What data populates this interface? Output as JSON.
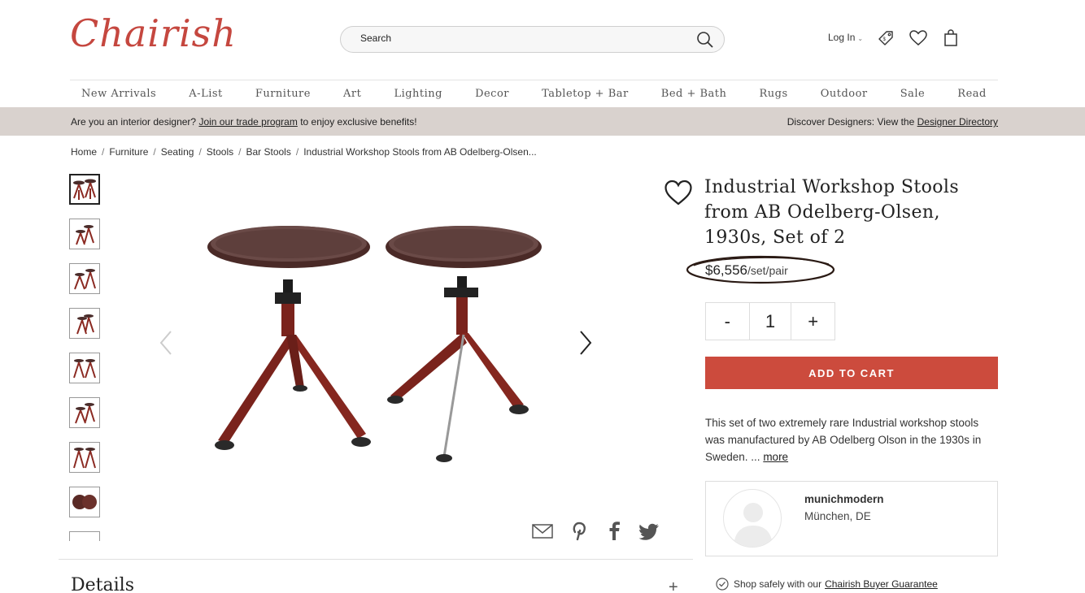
{
  "brand": {
    "logo_text": "Chairish",
    "accent_color": "#cc4b3d"
  },
  "header": {
    "search": {
      "placeholder": "Search",
      "icon": "search-icon"
    },
    "login_label": "Log In",
    "icons": [
      "price-tag-icon",
      "heart-icon",
      "shopping-bag-icon"
    ]
  },
  "nav": {
    "items": [
      "New Arrivals",
      "A-List",
      "Furniture",
      "Art",
      "Lighting",
      "Decor",
      "Tabletop + Bar",
      "Bed + Bath",
      "Rugs",
      "Outdoor",
      "Sale",
      "Read"
    ]
  },
  "promo": {
    "left_prefix": "Are you an interior designer?",
    "left_link": "Join our trade program",
    "left_suffix": "to enjoy exclusive benefits!",
    "right_prefix": "Discover Designers: View the",
    "right_link": "Designer Directory"
  },
  "breadcrumb": [
    "Home",
    "Furniture",
    "Seating",
    "Stools",
    "Bar Stools",
    "Industrial Workshop Stools from AB Odelberg-Olsen..."
  ],
  "product": {
    "title": "Industrial Workshop Stools from AB Odelberg-Olsen, 1930s, Set of 2",
    "price": "$6,556",
    "price_unit": "/set/pair",
    "quantity": {
      "minus": "-",
      "value": "1",
      "plus": "+"
    },
    "add_to_cart": "ADD TO CART",
    "description": "This set of two extremely rare Industrial workshop stools was manufactured by AB Odelberg Olson in the 1930s in Sweden. ...",
    "more_label": "more"
  },
  "seller": {
    "name": "munichmodern",
    "location": "München, DE"
  },
  "guarantee": {
    "prefix": "Shop safely with our",
    "link": "Chairish Buyer Guarantee"
  },
  "details": {
    "heading": "Details",
    "toggle": "+"
  },
  "share_icons": [
    "email-icon",
    "pinterest-icon",
    "facebook-icon",
    "twitter-icon"
  ]
}
